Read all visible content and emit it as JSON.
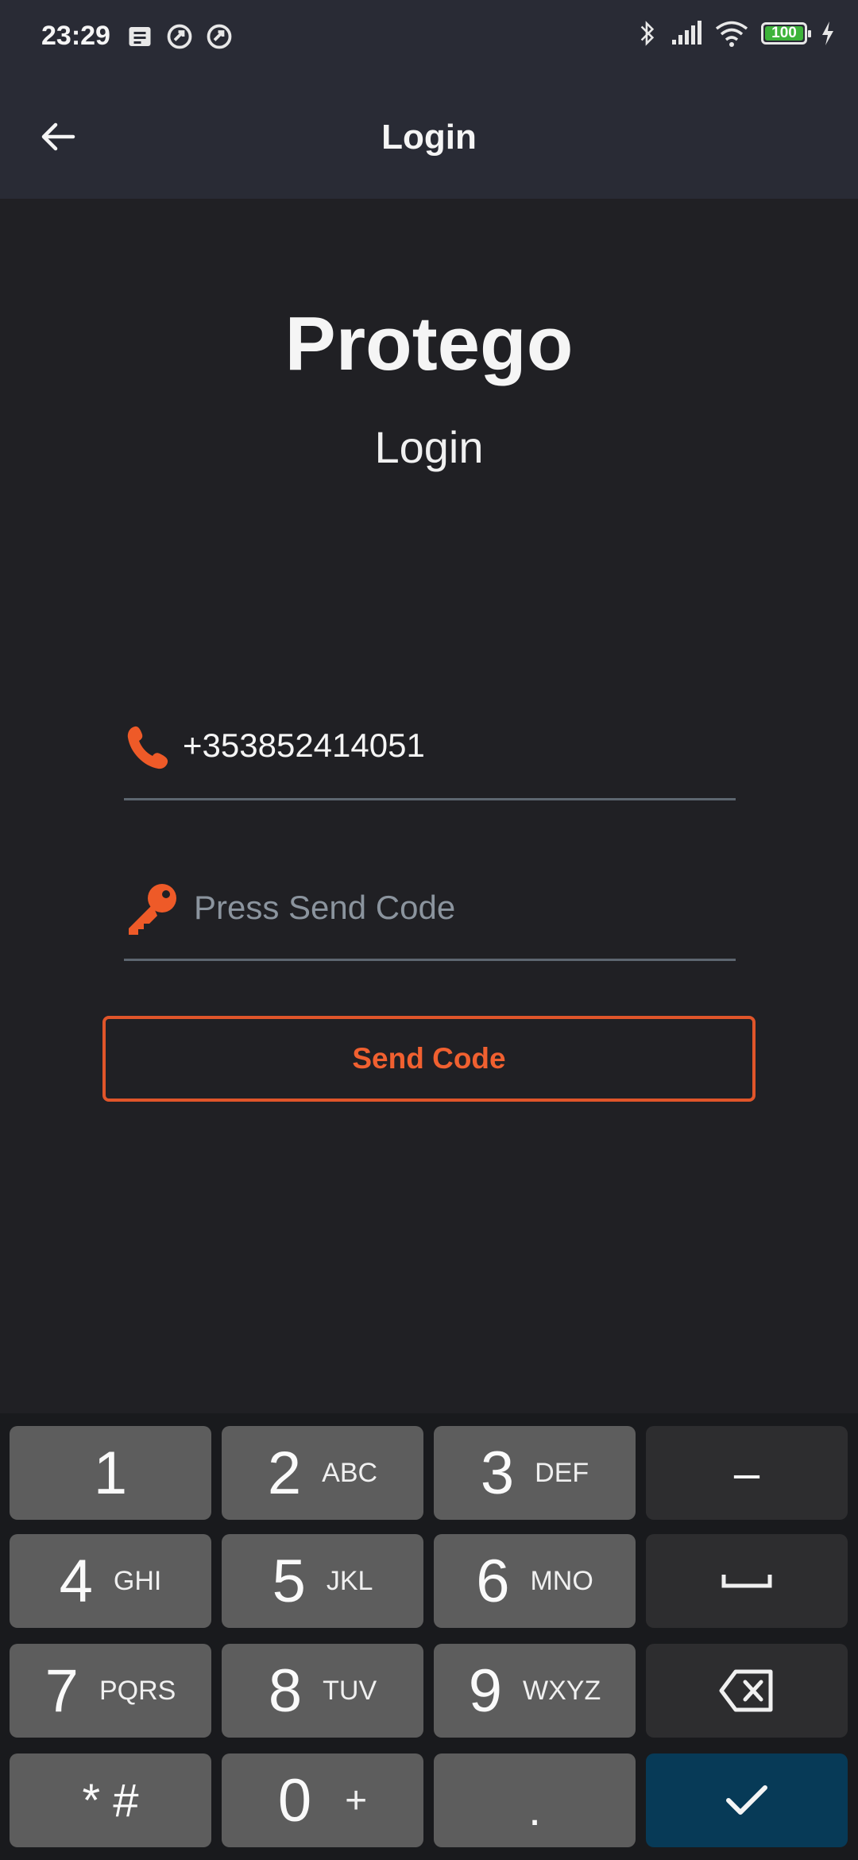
{
  "status_bar": {
    "time": "23:29",
    "battery": "100",
    "icons": [
      "message-icon",
      "sync-icon",
      "sync-icon",
      "bluetooth-icon",
      "signal-icon",
      "wifi-icon",
      "battery-icon",
      "charging-icon"
    ]
  },
  "app_bar": {
    "title": "Login",
    "back_icon": "arrow-back-icon"
  },
  "header": {
    "brand": "Protego",
    "subtitle": "Login"
  },
  "form": {
    "phone_value": "+353852414051",
    "code_placeholder": "Press Send Code",
    "send_button_label": "Send Code"
  },
  "keypad": {
    "keys": [
      {
        "digit": "1",
        "letters": ""
      },
      {
        "digit": "2",
        "letters": "ABC"
      },
      {
        "digit": "3",
        "letters": "DEF"
      },
      {
        "digit": "4",
        "letters": "GHI"
      },
      {
        "digit": "5",
        "letters": "JKL"
      },
      {
        "digit": "6",
        "letters": "MNO"
      },
      {
        "digit": "7",
        "letters": "PQRS"
      },
      {
        "digit": "8",
        "letters": "TUV"
      },
      {
        "digit": "9",
        "letters": "WXYZ"
      },
      {
        "digit": "* #",
        "letters": ""
      },
      {
        "digit": "0",
        "letters": "+"
      },
      {
        "digit": ".",
        "letters": ""
      }
    ],
    "minus_label": "–",
    "colors": {
      "accent": "#e0552a",
      "confirm": "#073a57"
    }
  }
}
